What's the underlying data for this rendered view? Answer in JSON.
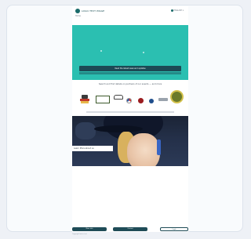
{
  "header": {
    "logo_text": "LOGO·TEXT·IMAGE",
    "language": "ENGLISH ▾",
    "home_link": "Home",
    "nav": [
      "",
      "",
      "",
      "",
      "",
      "",
      "",
      "",
      "",
      "",
      "",
      ""
    ]
  },
  "hero": {
    "cta_label": "Read the latest news and updates"
  },
  "partners": {
    "heading": "Search and find details on partners of our events — and more"
  },
  "photo": {
    "caption": "Learn More about us"
  },
  "footer": {
    "button_1": "More info",
    "button_2": "Contact",
    "button_3": "Login",
    "text": "Copyright footer text"
  },
  "colors": {
    "hero": "#2bbfb1",
    "brand_dark": "#1c4a55",
    "background": "#eef1f6"
  }
}
